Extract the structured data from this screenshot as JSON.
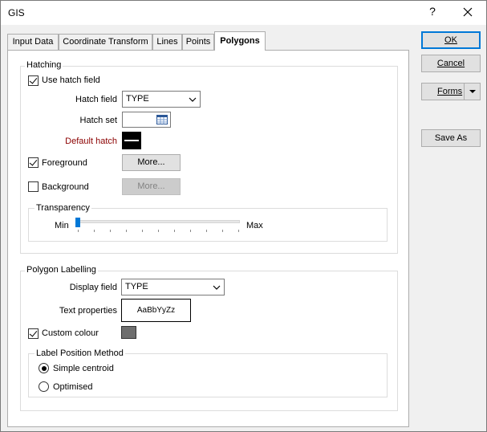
{
  "window": {
    "title": "GIS",
    "help_label": "?"
  },
  "tabs": [
    {
      "label": "Input Data",
      "active": false
    },
    {
      "label": "Coordinate Transform",
      "active": false
    },
    {
      "label": "Lines",
      "active": false
    },
    {
      "label": "Points",
      "active": false
    },
    {
      "label": "Polygons",
      "active": true
    }
  ],
  "buttons": {
    "ok": "OK",
    "cancel": "Cancel",
    "forms": "Forms",
    "save_as": "Save As"
  },
  "hatching": {
    "group_label": "Hatching",
    "use_hatch_field": {
      "label": "Use hatch field",
      "checked": true
    },
    "hatch_field": {
      "label": "Hatch field",
      "value": "TYPE"
    },
    "hatch_set": {
      "label": "Hatch set",
      "value": ""
    },
    "default_hatch": {
      "label": "Default hatch"
    },
    "foreground": {
      "label": "Foreground",
      "checked": true,
      "button": "More..."
    },
    "background": {
      "label": "Background",
      "checked": false,
      "button": "More..."
    },
    "transparency": {
      "group_label": "Transparency",
      "min_label": "Min",
      "max_label": "Max",
      "value": 0
    }
  },
  "labelling": {
    "group_label": "Polygon Labelling",
    "display_field": {
      "label": "Display field",
      "value": "TYPE"
    },
    "text_properties": {
      "label": "Text properties",
      "preview": "AaBbYyZz"
    },
    "custom_colour": {
      "label": "Custom colour",
      "checked": true,
      "swatch": "#6e6e6e"
    },
    "position_method": {
      "group_label": "Label Position Method",
      "options": [
        {
          "label": "Simple centroid",
          "selected": true
        },
        {
          "label": "Optimised",
          "selected": false
        }
      ]
    }
  },
  "colors": {
    "accent": "#0078d7",
    "default_hatch_label": "#8b0000"
  }
}
